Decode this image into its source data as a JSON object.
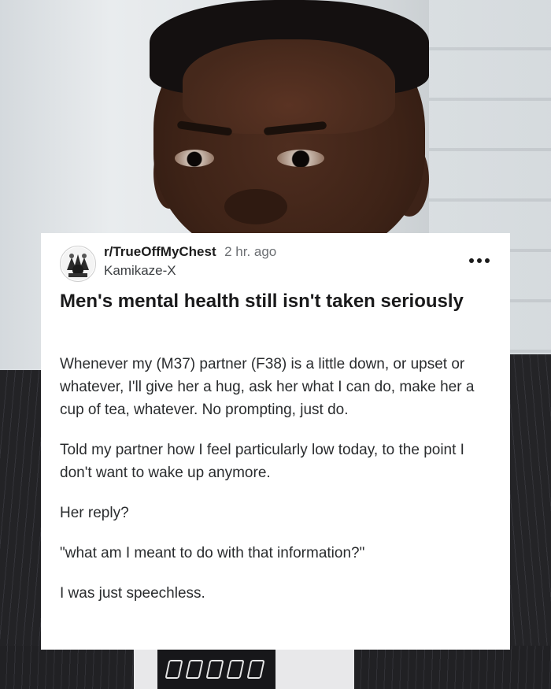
{
  "post": {
    "subreddit": "r/TrueOffMyChest",
    "time_ago": "2 hr. ago",
    "author": "Kamikaze-X",
    "more_icon": "more-options-icon",
    "title": "Men's mental health still isn't taken seriously",
    "paragraphs": [
      "Whenever my (M37) partner (F38) is a little down, or upset or whatever, I'll give her a hug, ask her what I can do, make her a cup of tea, whatever. No prompting, just do.",
      "Told my partner how I feel particularly low today, to the point I don't want to wake up anymore.",
      "Her reply?",
      "\"what am I meant to do with that information?\"",
      "I was just speechless."
    ]
  },
  "colors": {
    "card_background": "#ffffff",
    "title_text": "#1a1a1b",
    "meta_text": "#6c6f73"
  }
}
